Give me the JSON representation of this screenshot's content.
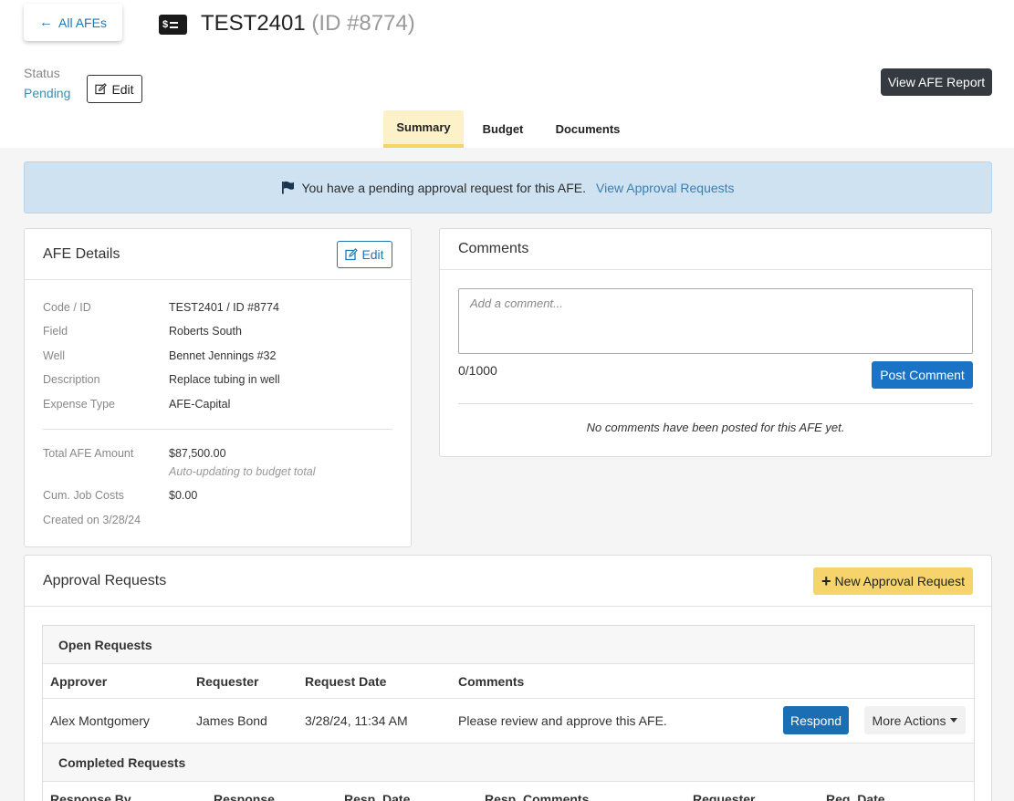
{
  "header": {
    "back_label": "All AFEs",
    "title": "TEST2401",
    "title_id": "(ID #8774)",
    "afe_icon_text": "$",
    "status_label": "Status",
    "status_value": "Pending",
    "status_edit_label": "Edit",
    "report_button": "View AFE Report"
  },
  "tabs": [
    {
      "label": "Summary",
      "active": true
    },
    {
      "label": "Budget",
      "active": false
    },
    {
      "label": "Documents",
      "active": false
    }
  ],
  "alert": {
    "text": "You have a pending approval request for this AFE.",
    "link": "View Approval Requests"
  },
  "afe_details": {
    "title": "AFE Details",
    "edit_label": "Edit",
    "rows": [
      {
        "label": "Code / ID",
        "value": "TEST2401 / ID #8774"
      },
      {
        "label": "Field",
        "value": "Roberts South"
      },
      {
        "label": "Well",
        "value": "Bennet Jennings #32"
      },
      {
        "label": "Description",
        "value": "Replace tubing in well"
      },
      {
        "label": "Expense Type",
        "value": "AFE-Capital"
      }
    ],
    "total_label": "Total AFE Amount",
    "total_value": "$87,500.00",
    "total_note": "Auto-updating to budget total",
    "cum_label": "Cum. Job Costs",
    "cum_value": "$0.00",
    "created": "Created on 3/28/24"
  },
  "comments": {
    "title": "Comments",
    "placeholder": "Add a comment...",
    "counter": "0/1000",
    "post_label": "Post Comment",
    "empty_text": "No comments have been posted for this AFE yet."
  },
  "approvals": {
    "title": "Approval Requests",
    "new_label": "New Approval Request",
    "open_title": "Open Requests",
    "open_columns": [
      "Approver",
      "Requester",
      "Request Date",
      "Comments"
    ],
    "open_rows": [
      {
        "approver": "Alex Montgomery",
        "requester": "James Bond",
        "date": "3/28/24, 11:34 AM",
        "comments": "Please review and approve this AFE.",
        "respond_label": "Respond",
        "more_label": "More Actions"
      }
    ],
    "completed_title": "Completed Requests",
    "completed_columns": [
      "Response By",
      "Response",
      "Resp. Date",
      "Resp. Comments",
      "Requester",
      "Req. Date"
    ]
  },
  "colors": {
    "accent": "#1f77b4",
    "alert_bg": "#cfe2f1",
    "tab_active": "#fdf1c9",
    "new_request": "#f7d46b",
    "dark_button": "#343a40"
  }
}
